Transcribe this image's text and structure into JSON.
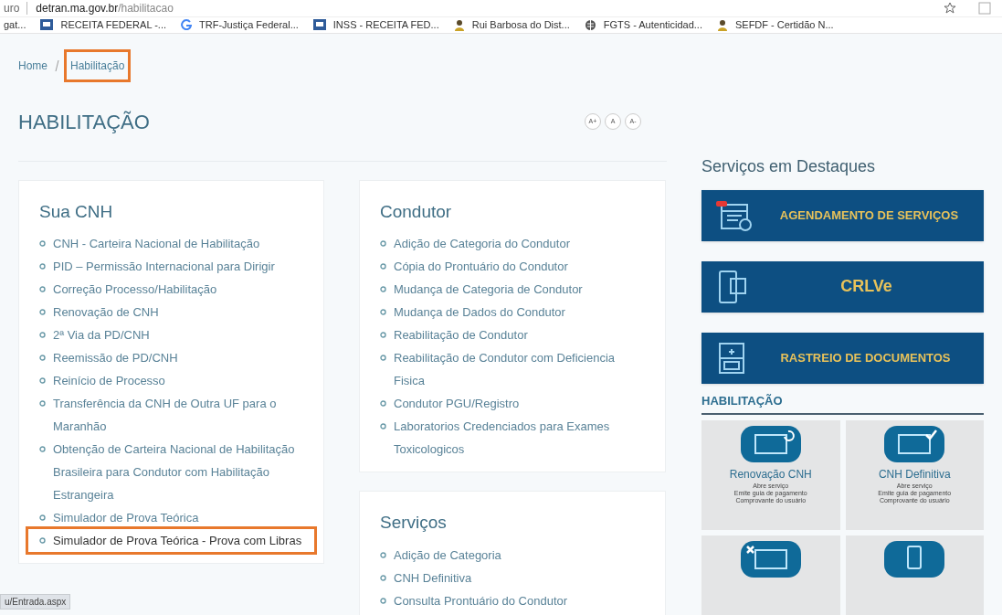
{
  "address_bar": {
    "prefix": "uro",
    "host": "detran.ma.gov.br",
    "path": "/habilitacao"
  },
  "bookmarks": [
    {
      "label": "gat...",
      "kind": "none"
    },
    {
      "label": "RECEITA FEDERAL -...",
      "kind": "site"
    },
    {
      "label": "TRF-Justiça Federal...",
      "kind": "g"
    },
    {
      "label": "INSS - RECEITA FED...",
      "kind": "site"
    },
    {
      "label": "Rui Barbosa do Dist...",
      "kind": "person"
    },
    {
      "label": "FGTS - Autenticidad...",
      "kind": "globe"
    },
    {
      "label": "SEFDF - Certidão N...",
      "kind": "person"
    }
  ],
  "breadcrumb": [
    {
      "label": "Home",
      "highlighted": false
    },
    {
      "label": "Habilitação",
      "highlighted": true
    }
  ],
  "page_title": "HABILITAÇÃO",
  "font_size_buttons": [
    "A+",
    "A",
    "A-"
  ],
  "sections": [
    {
      "title": "Sua CNH",
      "items": [
        {
          "label": "CNH - Carteira Nacional de Habilitação",
          "highlighted": false
        },
        {
          "label": "PID – Permissão Internacional para Dirigir",
          "highlighted": false
        },
        {
          "label": "Correção Processo/Habilitação",
          "highlighted": false
        },
        {
          "label": "Renovação de CNH",
          "highlighted": false
        },
        {
          "label": "2ª Via da PD/CNH",
          "highlighted": false
        },
        {
          "label": "Reemissão de PD/CNH",
          "highlighted": false
        },
        {
          "label": "Reinício de Processo",
          "highlighted": false
        },
        {
          "label": "Transferência da CNH de Outra UF para o Maranhão",
          "highlighted": false
        },
        {
          "label": "Obtenção de Carteira Nacional de Habilitação Brasileira para Condutor com Habilitação Estrangeira",
          "highlighted": false
        },
        {
          "label": "Simulador de Prova Teórica",
          "highlighted": false
        },
        {
          "label": "Simulador de Prova Teórica - Prova com Libras",
          "highlighted": true
        }
      ]
    },
    {
      "title": "Condutor",
      "items": [
        {
          "label": "Adição de Categoria do Condutor",
          "highlighted": false
        },
        {
          "label": "Cópia do Prontuário do Condutor",
          "highlighted": false
        },
        {
          "label": "Mudança de Categoria de Condutor",
          "highlighted": false
        },
        {
          "label": "Mudança de Dados do Condutor",
          "highlighted": false
        },
        {
          "label": "Reabilitação de Condutor",
          "highlighted": false
        },
        {
          "label": "Reabilitação de Condutor com Deficiencia Fisica",
          "highlighted": false
        },
        {
          "label": "Condutor PGU/Registro",
          "highlighted": false
        },
        {
          "label": "Laboratorios Credenciados para Exames Toxicologicos",
          "highlighted": false
        }
      ]
    },
    {
      "title": "Serviços",
      "items": [
        {
          "label": "Adição de Categoria",
          "highlighted": false
        },
        {
          "label": "CNH Definitiva",
          "highlighted": false
        },
        {
          "label": "Consulta Prontuário do Condutor",
          "highlighted": false
        }
      ]
    }
  ],
  "featured": {
    "title": "Serviços em Destaques",
    "banners": [
      {
        "title": "AGENDAMENTO DE SERVIÇOS",
        "kind": "calendar"
      },
      {
        "title": "CRLVe",
        "kind": "phone"
      },
      {
        "title": "RASTREIO DE DOCUMENTOS",
        "kind": "document"
      }
    ]
  },
  "habilitacao_panel": {
    "title": "HABILITAÇÃO",
    "tiles": [
      {
        "title": "Renovação CNH",
        "lines": [
          "Abre serviço",
          "Emite guia de pagamento",
          "Comprovante do usuário"
        ],
        "kind": "renew"
      },
      {
        "title": "CNH Definitiva",
        "lines": [
          "Abre serviço",
          "Emite guia de pagamento",
          "Comprovante do usuário"
        ],
        "kind": "check"
      },
      {
        "kind": "cross"
      },
      {
        "kind": "phone"
      }
    ]
  },
  "status_bar": "u/Entrada.aspx"
}
